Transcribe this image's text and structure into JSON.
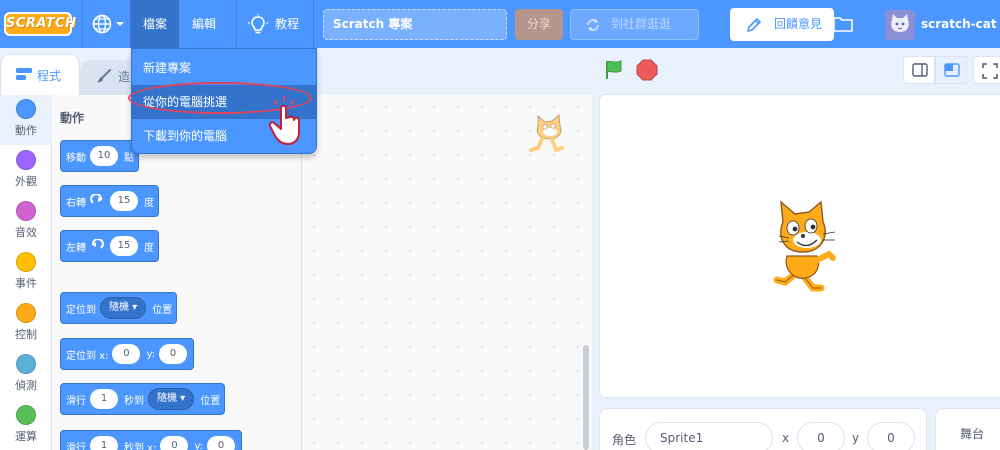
{
  "menubar": {
    "logo": "SCRATCH",
    "file": "檔案",
    "edit": "編輯",
    "tutorials": "教程",
    "project_title": "Scratch 專案",
    "share": "分享",
    "see_community": "到社群逛逛",
    "feedback": "回饋意見",
    "username": "scratch-cat",
    "icons": [
      "globe-icon",
      "lightbulb-icon",
      "refresh-icon",
      "pencil-icon",
      "folder-icon",
      "cat-avatar"
    ]
  },
  "file_menu": {
    "items": [
      "新建專案",
      "從你的電腦挑選",
      "下載到你的電腦"
    ],
    "highlighted_index": 1
  },
  "tabs": {
    "code": "程式",
    "costumes": "造"
  },
  "categories": [
    {
      "label": "動作",
      "color": "#4c97ff"
    },
    {
      "label": "外觀",
      "color": "#9966ff"
    },
    {
      "label": "音效",
      "color": "#cf63cf"
    },
    {
      "label": "事件",
      "color": "#ffbf00"
    },
    {
      "label": "控制",
      "color": "#ffab19"
    },
    {
      "label": "偵測",
      "color": "#5cb1d6"
    },
    {
      "label": "運算",
      "color": "#59c059"
    }
  ],
  "palette": {
    "title": "動作",
    "move": {
      "prefix": "移動",
      "value": "10",
      "suffix": "點"
    },
    "turn_right": {
      "prefix": "右轉",
      "value": "15",
      "suffix": "度"
    },
    "turn_left": {
      "prefix": "左轉",
      "value": "15",
      "suffix": "度"
    },
    "go_to": {
      "prefix": "定位到",
      "dropdown": "隨機",
      "suffix": "位置"
    },
    "go_to_xy": {
      "prefix": "定位到 x:",
      "x": "0",
      "y_label": "y:",
      "y": "0"
    },
    "glide": {
      "prefix": "滑行",
      "value": "1",
      "mid": "秒到",
      "dropdown": "隨機",
      "suffix": "位置"
    },
    "glide_xy": {
      "prefix": "滑行",
      "value": "1",
      "mid": "秒到 x:",
      "x": "0",
      "y_label": "y:",
      "y": "0"
    }
  },
  "sprite_info": {
    "label": "角色",
    "name": "Sprite1",
    "x_label": "x",
    "x": "0",
    "y_label": "y",
    "y": "0"
  },
  "stage_pane": {
    "label": "舞台"
  }
}
